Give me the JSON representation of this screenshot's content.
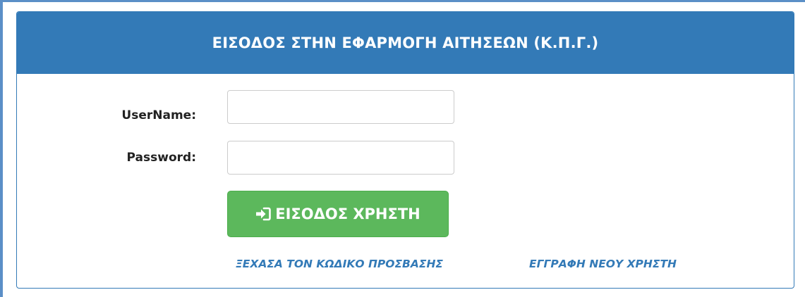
{
  "panel": {
    "title": "ΕΙΣΟΔΟΣ ΣΤΗΝ ΕΦΑΡΜΟΓΗ ΑΙΤΗΣΕΩΝ (Κ.Π.Γ.)"
  },
  "form": {
    "username_label": "UserName:",
    "username_value": "",
    "password_label": "Password:",
    "password_value": "",
    "login_button_label": "ΕΙΣΟΔΟΣ ΧΡΗΣΤΗ",
    "login_icon": "sign-in-icon"
  },
  "links": {
    "forgot_password": "ΞΕΧΑΣΑ ΤΟΝ ΚΩΔΙΚΟ ΠΡΟΣΒΑΣΗΣ",
    "register": "ΕΓΓΡΑΦΗ ΝΕΟΥ ΧΡΗΣΤΗ"
  },
  "colors": {
    "header_bg": "#337ab7",
    "button_bg": "#5cb85c",
    "link": "#337ab7"
  }
}
